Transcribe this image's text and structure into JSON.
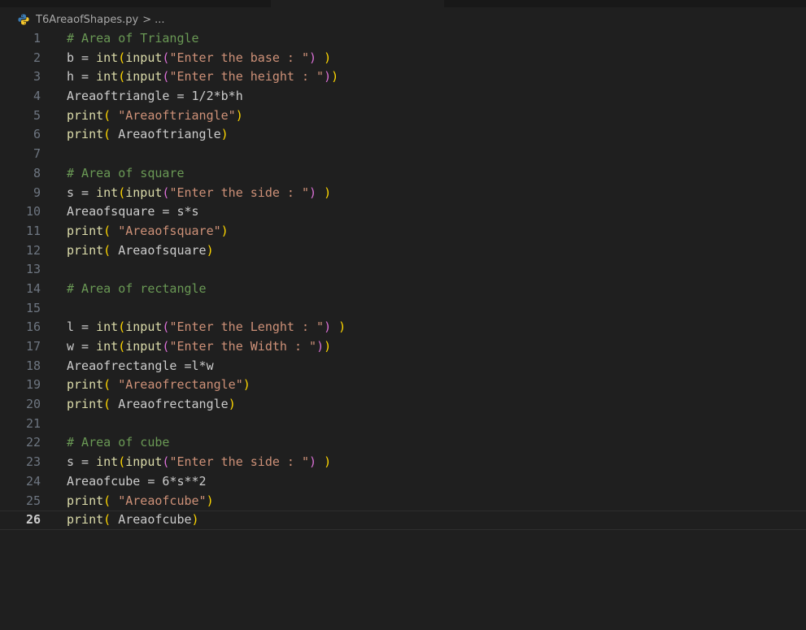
{
  "tabstrip": {},
  "breadcrumb": {
    "file_icon": "python-icon",
    "file_name": "T6AreaofShapes.py",
    "separator": ">",
    "more": "..."
  },
  "editor": {
    "current_line": 26,
    "lines": [
      {
        "n": "1",
        "tokens": [
          {
            "t": "# Area of Triangle",
            "k": "com"
          }
        ]
      },
      {
        "n": "2",
        "tokens": [
          {
            "t": "b = ",
            "k": "var"
          },
          {
            "t": "int",
            "k": "fn"
          },
          {
            "t": "(",
            "k": "p1"
          },
          {
            "t": "input",
            "k": "fn"
          },
          {
            "t": "(",
            "k": "p2"
          },
          {
            "t": "\"Enter the base : \"",
            "k": "str"
          },
          {
            "t": ")",
            "k": "p2"
          },
          {
            "t": " )",
            "k": "p1"
          }
        ]
      },
      {
        "n": "3",
        "tokens": [
          {
            "t": "h = ",
            "k": "var"
          },
          {
            "t": "int",
            "k": "fn"
          },
          {
            "t": "(",
            "k": "p1"
          },
          {
            "t": "input",
            "k": "fn"
          },
          {
            "t": "(",
            "k": "p2"
          },
          {
            "t": "\"Enter the height : \"",
            "k": "str"
          },
          {
            "t": ")",
            "k": "p2"
          },
          {
            "t": ")",
            "k": "p1"
          }
        ]
      },
      {
        "n": "4",
        "tokens": [
          {
            "t": "Areaoftriangle = 1/2*b*h",
            "k": "var"
          }
        ]
      },
      {
        "n": "5",
        "tokens": [
          {
            "t": "print",
            "k": "fn"
          },
          {
            "t": "( ",
            "k": "p1"
          },
          {
            "t": "\"Areaoftriangle\"",
            "k": "str"
          },
          {
            "t": ")",
            "k": "p1"
          }
        ]
      },
      {
        "n": "6",
        "tokens": [
          {
            "t": "print",
            "k": "fn"
          },
          {
            "t": "( ",
            "k": "p1"
          },
          {
            "t": "Areaoftriangle",
            "k": "var"
          },
          {
            "t": ")",
            "k": "p1"
          }
        ]
      },
      {
        "n": "7",
        "tokens": []
      },
      {
        "n": "8",
        "tokens": [
          {
            "t": "# Area of square",
            "k": "com"
          }
        ]
      },
      {
        "n": "9",
        "tokens": [
          {
            "t": "s = ",
            "k": "var"
          },
          {
            "t": "int",
            "k": "fn"
          },
          {
            "t": "(",
            "k": "p1"
          },
          {
            "t": "input",
            "k": "fn"
          },
          {
            "t": "(",
            "k": "p2"
          },
          {
            "t": "\"Enter the side : \"",
            "k": "str"
          },
          {
            "t": ")",
            "k": "p2"
          },
          {
            "t": " )",
            "k": "p1"
          }
        ]
      },
      {
        "n": "10",
        "tokens": [
          {
            "t": "Areaofsquare = s*s",
            "k": "var"
          }
        ]
      },
      {
        "n": "11",
        "tokens": [
          {
            "t": "print",
            "k": "fn"
          },
          {
            "t": "( ",
            "k": "p1"
          },
          {
            "t": "\"Areaofsquare\"",
            "k": "str"
          },
          {
            "t": ")",
            "k": "p1"
          }
        ]
      },
      {
        "n": "12",
        "tokens": [
          {
            "t": "print",
            "k": "fn"
          },
          {
            "t": "( ",
            "k": "p1"
          },
          {
            "t": "Areaofsquare",
            "k": "var"
          },
          {
            "t": ")",
            "k": "p1"
          }
        ]
      },
      {
        "n": "13",
        "tokens": []
      },
      {
        "n": "14",
        "tokens": [
          {
            "t": "# Area of rectangle",
            "k": "com"
          }
        ]
      },
      {
        "n": "15",
        "tokens": []
      },
      {
        "n": "16",
        "tokens": [
          {
            "t": "l = ",
            "k": "var"
          },
          {
            "t": "int",
            "k": "fn"
          },
          {
            "t": "(",
            "k": "p1"
          },
          {
            "t": "input",
            "k": "fn"
          },
          {
            "t": "(",
            "k": "p2"
          },
          {
            "t": "\"Enter the Lenght : \"",
            "k": "str"
          },
          {
            "t": ")",
            "k": "p2"
          },
          {
            "t": " )",
            "k": "p1"
          }
        ]
      },
      {
        "n": "17",
        "tokens": [
          {
            "t": "w = ",
            "k": "var"
          },
          {
            "t": "int",
            "k": "fn"
          },
          {
            "t": "(",
            "k": "p1"
          },
          {
            "t": "input",
            "k": "fn"
          },
          {
            "t": "(",
            "k": "p2"
          },
          {
            "t": "\"Enter the Width : \"",
            "k": "str"
          },
          {
            "t": ")",
            "k": "p2"
          },
          {
            "t": ")",
            "k": "p1"
          }
        ]
      },
      {
        "n": "18",
        "tokens": [
          {
            "t": "Areaofrectangle =l*w",
            "k": "var"
          }
        ]
      },
      {
        "n": "19",
        "tokens": [
          {
            "t": "print",
            "k": "fn"
          },
          {
            "t": "( ",
            "k": "p1"
          },
          {
            "t": "\"Areaofrectangle\"",
            "k": "str"
          },
          {
            "t": ")",
            "k": "p1"
          }
        ]
      },
      {
        "n": "20",
        "tokens": [
          {
            "t": "print",
            "k": "fn"
          },
          {
            "t": "( ",
            "k": "p1"
          },
          {
            "t": "Areaofrectangle",
            "k": "var"
          },
          {
            "t": ")",
            "k": "p1"
          }
        ]
      },
      {
        "n": "21",
        "tokens": []
      },
      {
        "n": "22",
        "tokens": [
          {
            "t": "# Area of cube",
            "k": "com"
          }
        ]
      },
      {
        "n": "23",
        "tokens": [
          {
            "t": "s = ",
            "k": "var"
          },
          {
            "t": "int",
            "k": "fn"
          },
          {
            "t": "(",
            "k": "p1"
          },
          {
            "t": "input",
            "k": "fn"
          },
          {
            "t": "(",
            "k": "p2"
          },
          {
            "t": "\"Enter the side : \"",
            "k": "str"
          },
          {
            "t": ")",
            "k": "p2"
          },
          {
            "t": " )",
            "k": "p1"
          }
        ]
      },
      {
        "n": "24",
        "tokens": [
          {
            "t": "Areaofcube = 6*s**2",
            "k": "var"
          }
        ]
      },
      {
        "n": "25",
        "tokens": [
          {
            "t": "print",
            "k": "fn"
          },
          {
            "t": "( ",
            "k": "p1"
          },
          {
            "t": "\"Areaofcube\"",
            "k": "str"
          },
          {
            "t": ")",
            "k": "p1"
          }
        ]
      },
      {
        "n": "26",
        "tokens": [
          {
            "t": "print",
            "k": "fn"
          },
          {
            "t": "( ",
            "k": "p1"
          },
          {
            "t": "Areaofcube",
            "k": "var"
          },
          {
            "t": ")",
            "k": "p1"
          }
        ]
      }
    ]
  },
  "colors": {
    "background": "#1f1f1f",
    "comment": "#6a9955",
    "function": "#dcdcaa",
    "string": "#ce9178",
    "text": "#cccccc",
    "bracket_level1": "#ffd700",
    "bracket_level2": "#da70d6",
    "line_number": "#6e7681",
    "python_icon_blue": "#3b79b0",
    "python_icon_yellow": "#f5c62b"
  }
}
